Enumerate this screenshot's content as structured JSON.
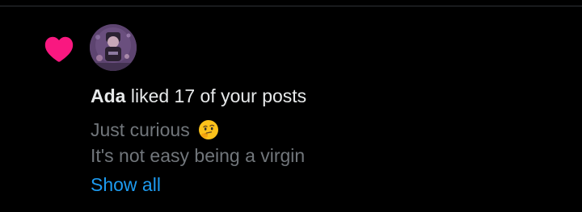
{
  "notification": {
    "user_name": "Ada",
    "action_text": " liked 17 of your posts",
    "posts": [
      {
        "text": "Just curious",
        "emoji": "thinking-face-icon"
      },
      {
        "text": "It's not easy being a virgin"
      }
    ],
    "show_all_label": "Show all",
    "icon": "heart-icon",
    "colors": {
      "heart": "#f91880",
      "link": "#1d9bf0",
      "secondary_text": "#71767b",
      "primary_text": "#e7e9ea",
      "background": "#000000"
    }
  }
}
